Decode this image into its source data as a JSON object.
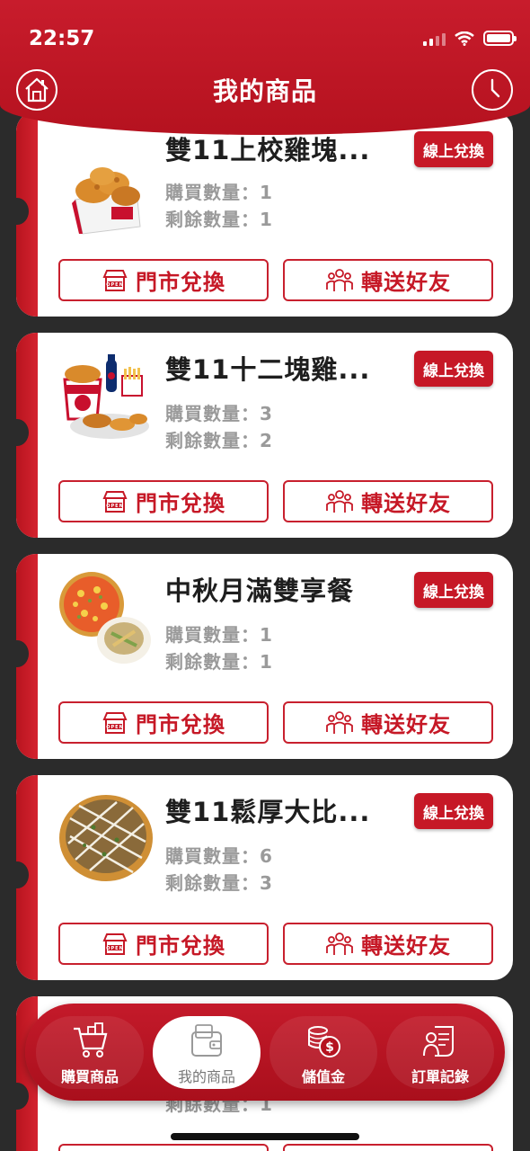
{
  "status_bar": {
    "time": "22:57"
  },
  "header": {
    "title": "我的商品"
  },
  "colors": {
    "brand_red": "#c61826",
    "background": "#2b2b2b"
  },
  "labels": {
    "online_redeem": "線上兌換",
    "store_redeem": "門市兌換",
    "transfer": "轉送好友",
    "bought_prefix": "購買數量：",
    "remain_prefix": "剩餘數量："
  },
  "products": [
    {
      "name": "雙11上校雞塊...",
      "bought": "1",
      "remaining": "1",
      "image": "chicken-nuggets"
    },
    {
      "name": "雙11十二塊雞...",
      "bought": "3",
      "remaining": "2",
      "image": "fried-chicken-bucket"
    },
    {
      "name": "中秋月滿雙享餐",
      "bought": "1",
      "remaining": "1",
      "image": "pizza-combo"
    },
    {
      "name": "雙11鬆厚大比...",
      "bought": "6",
      "remaining": "3",
      "image": "large-pizza"
    },
    {
      "name": "",
      "bought": "",
      "remaining": "1",
      "image": ""
    }
  ],
  "tabbar": {
    "items": [
      {
        "label": "購買商品",
        "icon": "cart-icon",
        "active": false
      },
      {
        "label": "我的商品",
        "icon": "wallet-icon",
        "active": true
      },
      {
        "label": "儲值金",
        "icon": "coins-icon",
        "active": false
      },
      {
        "label": "訂單記錄",
        "icon": "receipt-icon",
        "active": false
      }
    ]
  }
}
